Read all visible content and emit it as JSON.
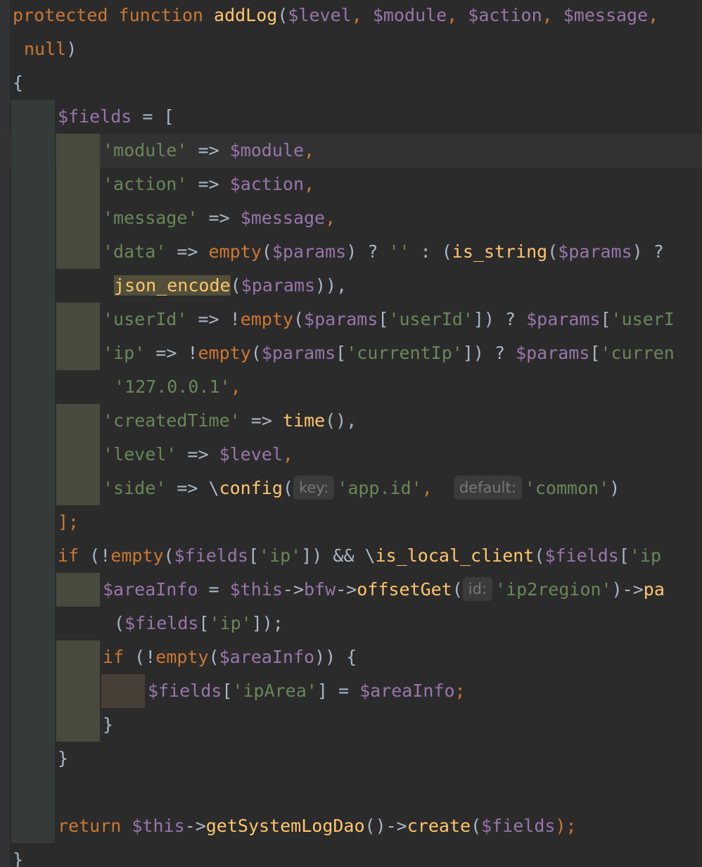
{
  "editor": {
    "lines": [
      {
        "indent": 0,
        "guides": [],
        "tokens": [
          {
            "t": "protected",
            "c": "kw"
          },
          {
            "t": " ",
            "c": "pl"
          },
          {
            "t": "function",
            "c": "kw"
          },
          {
            "t": " ",
            "c": "pl"
          },
          {
            "t": "addLog",
            "c": "fn"
          },
          {
            "t": "(",
            "c": "pl"
          },
          {
            "t": "$level",
            "c": "var"
          },
          {
            "t": ", ",
            "c": "kw"
          },
          {
            "t": "$module",
            "c": "var"
          },
          {
            "t": ", ",
            "c": "kw"
          },
          {
            "t": "$action",
            "c": "var"
          },
          {
            "t": ", ",
            "c": "kw"
          },
          {
            "t": "$message",
            "c": "var"
          },
          {
            "t": ",",
            "c": "kw"
          }
        ]
      },
      {
        "indent": 1,
        "guides": [],
        "tokens": [
          {
            "t": "null",
            "c": "kw"
          },
          {
            "t": ")",
            "c": "pl"
          }
        ]
      },
      {
        "indent": 0,
        "guides": [],
        "tokens": [
          {
            "t": "{",
            "c": "pl"
          }
        ]
      },
      {
        "indent": 4,
        "guides": [
          1
        ],
        "tokens": [
          {
            "t": "$fields",
            "c": "var"
          },
          {
            "t": " = [",
            "c": "pl"
          }
        ]
      },
      {
        "indent": 8,
        "guides": [
          1,
          2
        ],
        "current": true,
        "tokens": [
          {
            "t": "'module'",
            "c": "str"
          },
          {
            "t": " => ",
            "c": "pl"
          },
          {
            "t": "$module",
            "c": "var"
          },
          {
            "t": ",",
            "c": "kw"
          }
        ]
      },
      {
        "indent": 8,
        "guides": [
          1,
          2
        ],
        "tokens": [
          {
            "t": "'action'",
            "c": "str"
          },
          {
            "t": " => ",
            "c": "pl"
          },
          {
            "t": "$action",
            "c": "var"
          },
          {
            "t": ",",
            "c": "kw"
          }
        ]
      },
      {
        "indent": 8,
        "guides": [
          1,
          2
        ],
        "tokens": [
          {
            "t": "'message'",
            "c": "str"
          },
          {
            "t": " => ",
            "c": "pl"
          },
          {
            "t": "$message",
            "c": "var"
          },
          {
            "t": ",",
            "c": "kw"
          }
        ]
      },
      {
        "indent": 8,
        "guides": [
          1,
          2
        ],
        "tokens": [
          {
            "t": "'data'",
            "c": "str"
          },
          {
            "t": " => ",
            "c": "pl"
          },
          {
            "t": "empty",
            "c": "kw"
          },
          {
            "t": "(",
            "c": "pl"
          },
          {
            "t": "$params",
            "c": "var"
          },
          {
            "t": ") ? ",
            "c": "pl"
          },
          {
            "t": "''",
            "c": "str"
          },
          {
            "t": " : (",
            "c": "pl"
          },
          {
            "t": "is_string",
            "c": "fn"
          },
          {
            "t": "(",
            "c": "pl"
          },
          {
            "t": "$params",
            "c": "var"
          },
          {
            "t": ") ?",
            "c": "pl"
          }
        ]
      },
      {
        "indent": 9,
        "guides": [
          1
        ],
        "tokens": [
          {
            "t": "json_encode",
            "c": "fn",
            "hl": true
          },
          {
            "t": "(",
            "c": "pl"
          },
          {
            "t": "$params",
            "c": "var"
          },
          {
            "t": ")),",
            "c": "pl"
          }
        ]
      },
      {
        "indent": 8,
        "guides": [
          1,
          2
        ],
        "tokens": [
          {
            "t": "'userId'",
            "c": "str"
          },
          {
            "t": " => !",
            "c": "pl"
          },
          {
            "t": "empty",
            "c": "kw"
          },
          {
            "t": "(",
            "c": "pl"
          },
          {
            "t": "$params",
            "c": "var"
          },
          {
            "t": "[",
            "c": "pl"
          },
          {
            "t": "'userId'",
            "c": "str"
          },
          {
            "t": "]) ? ",
            "c": "pl"
          },
          {
            "t": "$params",
            "c": "var"
          },
          {
            "t": "[",
            "c": "pl"
          },
          {
            "t": "'userI",
            "c": "str"
          }
        ]
      },
      {
        "indent": 8,
        "guides": [
          1,
          2
        ],
        "tokens": [
          {
            "t": "'ip'",
            "c": "str"
          },
          {
            "t": " => !",
            "c": "pl"
          },
          {
            "t": "empty",
            "c": "kw"
          },
          {
            "t": "(",
            "c": "pl"
          },
          {
            "t": "$params",
            "c": "var"
          },
          {
            "t": "[",
            "c": "pl"
          },
          {
            "t": "'currentIp'",
            "c": "str"
          },
          {
            "t": "]) ? ",
            "c": "pl"
          },
          {
            "t": "$params",
            "c": "var"
          },
          {
            "t": "[",
            "c": "pl"
          },
          {
            "t": "'curren",
            "c": "str"
          }
        ]
      },
      {
        "indent": 9,
        "guides": [
          1
        ],
        "tokens": [
          {
            "t": "'127.0.0.1'",
            "c": "str"
          },
          {
            "t": ",",
            "c": "kw"
          }
        ]
      },
      {
        "indent": 8,
        "guides": [
          1,
          2
        ],
        "tokens": [
          {
            "t": "'createdTime'",
            "c": "str"
          },
          {
            "t": " => ",
            "c": "pl"
          },
          {
            "t": "time",
            "c": "fn"
          },
          {
            "t": "(),",
            "c": "pl"
          }
        ]
      },
      {
        "indent": 8,
        "guides": [
          1,
          2
        ],
        "tokens": [
          {
            "t": "'level'",
            "c": "str"
          },
          {
            "t": " => ",
            "c": "pl"
          },
          {
            "t": "$level",
            "c": "var"
          },
          {
            "t": ",",
            "c": "kw"
          }
        ]
      },
      {
        "indent": 8,
        "guides": [
          1,
          2
        ],
        "tokens": [
          {
            "t": "'side'",
            "c": "str"
          },
          {
            "t": " => \\",
            "c": "pl"
          },
          {
            "t": "config",
            "c": "fn"
          },
          {
            "t": "(",
            "c": "pl"
          },
          {
            "hint": "key:"
          },
          {
            "t": "'app.id'",
            "c": "str"
          },
          {
            "t": ",  ",
            "c": "kw"
          },
          {
            "hint": "default:"
          },
          {
            "t": "'common'",
            "c": "str"
          },
          {
            "t": ")",
            "c": "pl"
          }
        ]
      },
      {
        "indent": 4,
        "guides": [
          1
        ],
        "tokens": [
          {
            "t": "];",
            "c": "kw"
          }
        ]
      },
      {
        "indent": 4,
        "guides": [
          1
        ],
        "tokens": [
          {
            "t": "if",
            "c": "kw"
          },
          {
            "t": " (!",
            "c": "pl"
          },
          {
            "t": "empty",
            "c": "kw"
          },
          {
            "t": "(",
            "c": "pl"
          },
          {
            "t": "$fields",
            "c": "var"
          },
          {
            "t": "[",
            "c": "pl"
          },
          {
            "t": "'ip'",
            "c": "str"
          },
          {
            "t": "]) && \\",
            "c": "pl"
          },
          {
            "t": "is_local_client",
            "c": "fn"
          },
          {
            "t": "(",
            "c": "pl"
          },
          {
            "t": "$fields",
            "c": "var"
          },
          {
            "t": "[",
            "c": "pl"
          },
          {
            "t": "'ip",
            "c": "str"
          }
        ]
      },
      {
        "indent": 8,
        "guides": [
          1,
          2
        ],
        "tokens": [
          {
            "t": "$areaInfo",
            "c": "var"
          },
          {
            "t": " = ",
            "c": "pl"
          },
          {
            "t": "$this",
            "c": "var"
          },
          {
            "t": "->",
            "c": "pl"
          },
          {
            "t": "bfw",
            "c": "var"
          },
          {
            "t": "->",
            "c": "pl"
          },
          {
            "t": "offsetGet",
            "c": "fn"
          },
          {
            "t": "(",
            "c": "pl"
          },
          {
            "hint": "id:"
          },
          {
            "t": "'ip2region'",
            "c": "str"
          },
          {
            "t": ")->",
            "c": "pl"
          },
          {
            "t": "pa",
            "c": "fn"
          }
        ]
      },
      {
        "indent": 9,
        "guides": [
          1
        ],
        "tokens": [
          {
            "t": "(",
            "c": "pl"
          },
          {
            "t": "$fields",
            "c": "var"
          },
          {
            "t": "[",
            "c": "pl"
          },
          {
            "t": "'ip'",
            "c": "str"
          },
          {
            "t": "]);",
            "c": "pl"
          }
        ]
      },
      {
        "indent": 8,
        "guides": [
          1,
          2
        ],
        "tokens": [
          {
            "t": "if",
            "c": "kw"
          },
          {
            "t": " (!",
            "c": "pl"
          },
          {
            "t": "empty",
            "c": "kw"
          },
          {
            "t": "(",
            "c": "pl"
          },
          {
            "t": "$areaInfo",
            "c": "var"
          },
          {
            "t": ")) {",
            "c": "pl"
          }
        ]
      },
      {
        "indent": 12,
        "guides": [
          1,
          2,
          3
        ],
        "tokens": [
          {
            "t": "$fields",
            "c": "var"
          },
          {
            "t": "[",
            "c": "pl"
          },
          {
            "t": "'ipArea'",
            "c": "str"
          },
          {
            "t": "] = ",
            "c": "pl"
          },
          {
            "t": "$areaInfo",
            "c": "var"
          },
          {
            "t": ";",
            "c": "kw"
          }
        ]
      },
      {
        "indent": 8,
        "guides": [
          1,
          2
        ],
        "tokens": [
          {
            "t": "}",
            "c": "pl"
          }
        ]
      },
      {
        "indent": 4,
        "guides": [
          1
        ],
        "tokens": [
          {
            "t": "}",
            "c": "pl"
          }
        ]
      },
      {
        "indent": 4,
        "guides": [
          1
        ],
        "tokens": []
      },
      {
        "indent": 4,
        "guides": [
          1
        ],
        "tokens": [
          {
            "t": "return",
            "c": "kw"
          },
          {
            "t": " ",
            "c": "pl"
          },
          {
            "t": "$this",
            "c": "var"
          },
          {
            "t": "->",
            "c": "pl"
          },
          {
            "t": "getSystemLogDao",
            "c": "fn"
          },
          {
            "t": "()->",
            "c": "pl"
          },
          {
            "t": "create",
            "c": "fn"
          },
          {
            "t": "(",
            "c": "pl"
          },
          {
            "t": "$fields",
            "c": "var"
          },
          {
            "t": ");",
            "c": "kw"
          }
        ]
      },
      {
        "indent": 0,
        "guides": [],
        "tokens": [
          {
            "t": "}",
            "c": "pl"
          }
        ]
      }
    ]
  }
}
